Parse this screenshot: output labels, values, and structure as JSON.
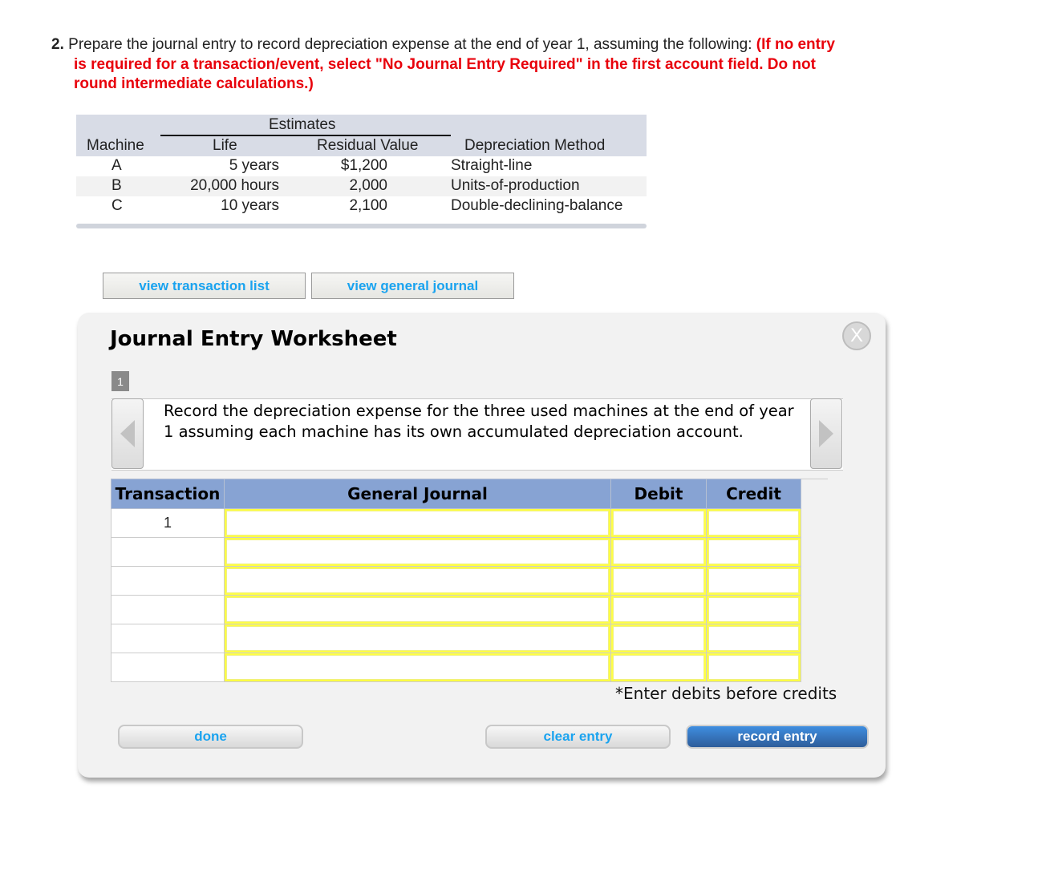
{
  "question": {
    "number": "2.",
    "text": "Prepare the journal entry to record depreciation expense at the end of year 1, assuming the following:",
    "instruction": "(If no entry is required for a transaction/event, select \"No Journal Entry Required\" in the first account field. Do not round intermediate calculations.)"
  },
  "estimates_table": {
    "group_header": "Estimates",
    "columns": [
      "Machine",
      "Life",
      "Residual Value",
      "Depreciation Method"
    ],
    "rows": [
      {
        "machine": "A",
        "life": "5 years",
        "residual": "$1,200",
        "method": "Straight-line"
      },
      {
        "machine": "B",
        "life": "20,000 hours",
        "residual": "2,000",
        "method": "Units-of-production"
      },
      {
        "machine": "C",
        "life": "10 years",
        "residual": "2,100",
        "method": "Double-declining-balance"
      }
    ]
  },
  "links": {
    "view_transaction_list": "view transaction list",
    "view_general_journal": "view general journal"
  },
  "worksheet": {
    "title": "Journal Entry Worksheet",
    "close_label": "X",
    "page": "1",
    "instruction": "Record the depreciation expense for the three used machines at the end of year 1 assuming each machine has its own accumulated depreciation account.",
    "columns": [
      "Transaction",
      "General Journal",
      "Debit",
      "Credit"
    ],
    "rows": [
      {
        "transaction": "1",
        "account": "",
        "debit": "",
        "credit": ""
      },
      {
        "transaction": "",
        "account": "",
        "debit": "",
        "credit": ""
      },
      {
        "transaction": "",
        "account": "",
        "debit": "",
        "credit": ""
      },
      {
        "transaction": "",
        "account": "",
        "debit": "",
        "credit": ""
      },
      {
        "transaction": "",
        "account": "",
        "debit": "",
        "credit": ""
      },
      {
        "transaction": "",
        "account": "",
        "debit": "",
        "credit": ""
      }
    ],
    "note": "*Enter debits before credits",
    "buttons": {
      "done": "done",
      "clear": "clear entry",
      "record": "record entry"
    }
  },
  "colors": {
    "instruction_red": "#e8000b",
    "link_blue": "#1aa3ef",
    "table_header_blue": "#87a3d3",
    "input_highlight": "#ffff44",
    "record_button": "#2e5d9a"
  }
}
